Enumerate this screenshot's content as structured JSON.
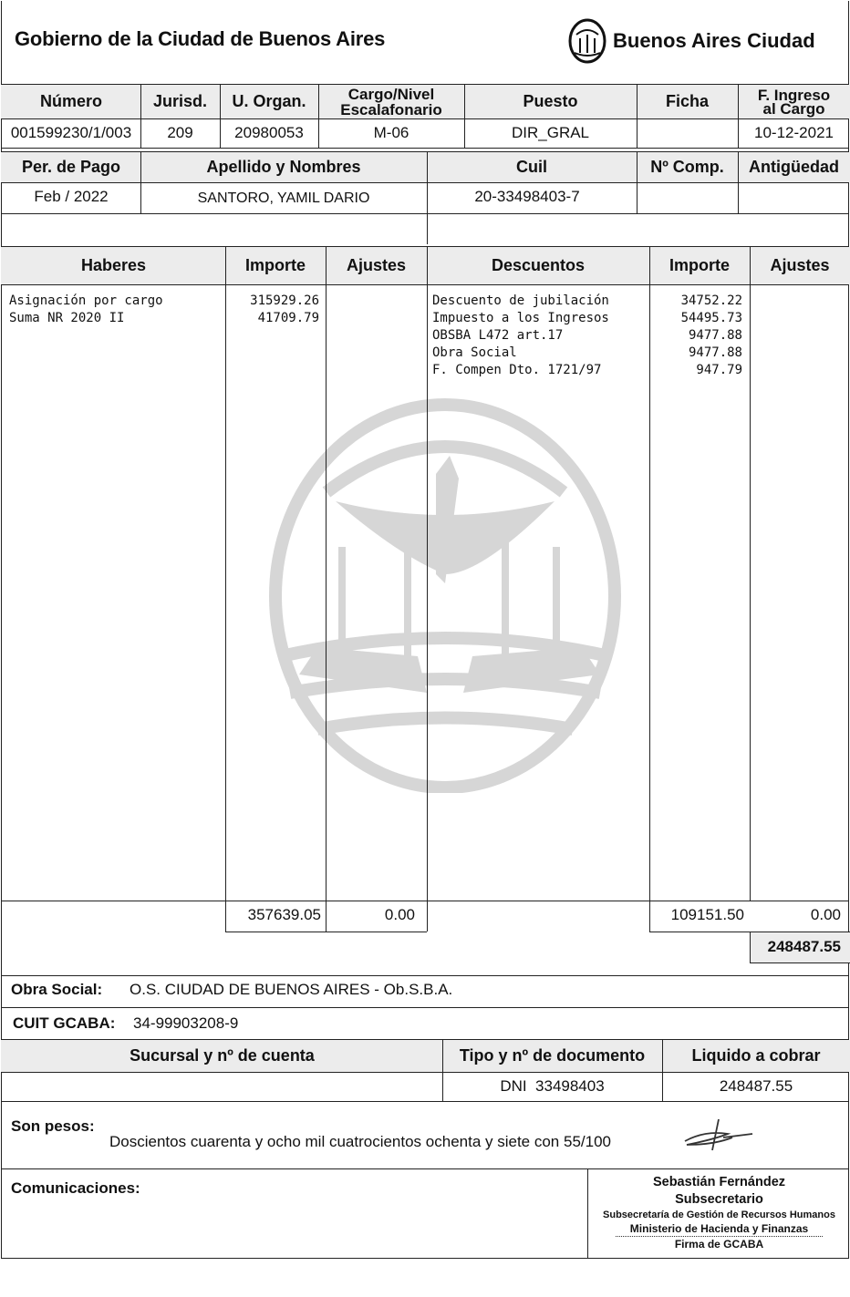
{
  "header": {
    "left_title": "Gobierno de la Ciudad de Buenos Aires",
    "logo_text": "Buenos Aires Ciudad",
    "logo_icon": "city-coat-of-arms-icon"
  },
  "row1": {
    "headers": [
      "Número",
      "Jurisd.",
      "U. Organ.",
      "Cargo/Nivel Escalafonario",
      "Puesto",
      "Ficha",
      "F. Ingreso al Cargo"
    ],
    "values": [
      "001599230/1/003",
      "209",
      "20980053",
      "M-06",
      "DIR_GRAL",
      "",
      "10-12-2021"
    ]
  },
  "row2": {
    "headers": [
      "Per. de Pago",
      "Apellido y Nombres",
      "Cuil",
      "Nº Comp.",
      "Antigüedad"
    ],
    "values": [
      "Feb / 2022",
      "SANTORO, YAMIL DARIO",
      "20-33498403-7",
      "",
      ""
    ]
  },
  "main_headers": {
    "haberes": "Haberes",
    "importe_left": "Importe",
    "ajustes_left": "Ajustes",
    "descuentos": "Descuentos",
    "importe_right": "Importe",
    "ajustes_right": "Ajustes"
  },
  "haberes": [
    {
      "concepto": "Asignación por cargo",
      "importe": "315929.26"
    },
    {
      "concepto": "Suma NR 2020 II",
      "importe": "41709.79"
    }
  ],
  "descuentos": [
    {
      "concepto": "Descuento de jubilación",
      "importe": "34752.22"
    },
    {
      "concepto": "Impuesto a los Ingresos",
      "importe": "54495.73"
    },
    {
      "concepto": "OBSBA L472 art.17",
      "importe": "9477.88"
    },
    {
      "concepto": "Obra Social",
      "importe": "9477.88"
    },
    {
      "concepto": "F. Compen Dto. 1721/97",
      "importe": "947.79"
    }
  ],
  "totals": {
    "haberes_total": "357639.05",
    "haberes_ajustes": "0.00",
    "descuentos_total": "109151.50",
    "descuentos_ajustes": "0.00",
    "neto": "248487.55"
  },
  "obra_social": {
    "label": "Obra Social:",
    "value": "O.S. CIUDAD DE BUENOS AIRES - Ob.S.B.A."
  },
  "cuit": {
    "label": "CUIT GCABA:",
    "value": "34-99903208-9"
  },
  "bottom_table": {
    "headers": [
      "Sucursal y nº de cuenta",
      "Tipo y nº de documento",
      "Liquido a cobrar"
    ],
    "values": [
      "",
      "DNI  33498403",
      "248487.55"
    ]
  },
  "son_pesos": {
    "label": "Son pesos:",
    "value": "Doscientos cuarenta y ocho mil cuatrocientos ochenta y siete con 55/100"
  },
  "comunicaciones": {
    "label": "Comunicaciones:"
  },
  "signature": {
    "name": "Sebastián Fernández",
    "role": "Subsecretario",
    "office": "Subsecretaría de Gestión de Recursos Humanos",
    "ministry": "Ministerio de Hacienda y Finanzas",
    "firma": "Firma de GCABA"
  },
  "colors": {
    "header_bg": "#ececec",
    "watermark": "#d6d6d6",
    "border": "#222222"
  }
}
